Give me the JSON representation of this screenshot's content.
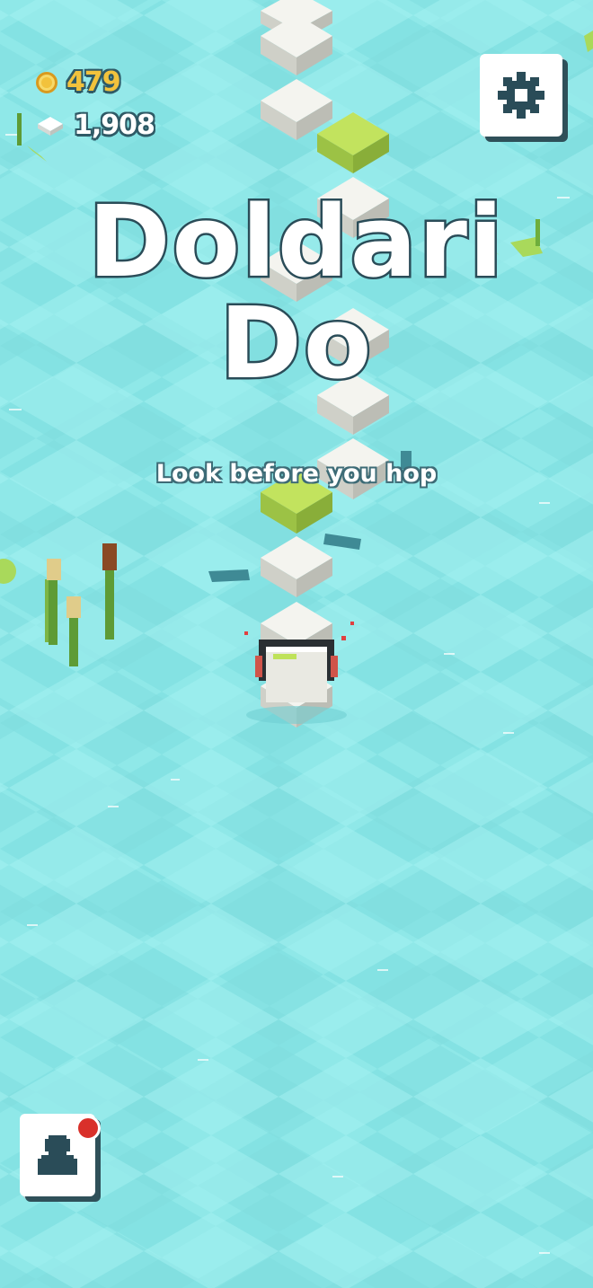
{
  "hud": {
    "coins": "479",
    "coin_icon": "coin-icon",
    "gems": "1,908",
    "gem_icon": "sugar-cube-icon"
  },
  "title": {
    "line1": "Doldari",
    "line2": "Do",
    "subtitle": "Look before you hop"
  },
  "buttons": {
    "settings_icon": "gear-icon",
    "profile_icon": "person-icon",
    "profile_notification": true
  },
  "colors": {
    "water": "#8fe8e8",
    "tile": "#f2f2ee",
    "tile_green": "#bfe25a",
    "outline": "#2a4c58",
    "coin": "#f2c23c"
  }
}
